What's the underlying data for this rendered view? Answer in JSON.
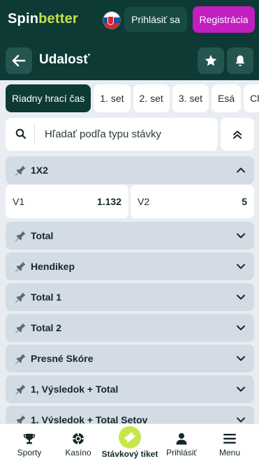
{
  "header": {
    "logo_spin": "Spin",
    "logo_better": "better",
    "login_label": "Prihlásiť sa",
    "register_label": "Registrácia"
  },
  "subheader": {
    "title": "Udalosť"
  },
  "tabs": [
    {
      "label": "Riadny hrací čas",
      "active": true
    },
    {
      "label": "1. set"
    },
    {
      "label": "2. set"
    },
    {
      "label": "3. set"
    },
    {
      "label": "Esá"
    },
    {
      "label": "Ch"
    }
  ],
  "search": {
    "placeholder": "Hľadať podľa typu stávky"
  },
  "markets": [
    {
      "name": "1X2",
      "expanded": true
    },
    {
      "name": "Total"
    },
    {
      "name": "Hendikep"
    },
    {
      "name": "Total 1"
    },
    {
      "name": "Total 2"
    },
    {
      "name": "Presné Skóre"
    },
    {
      "name": "1, Výsledok + Total"
    },
    {
      "name": "1, Výsledok + Total Setov"
    }
  ],
  "odds": [
    {
      "label": "V1",
      "value": "1.132"
    },
    {
      "label": "V2",
      "value": "5"
    }
  ],
  "bottom_nav": [
    {
      "label": "Sporty",
      "icon": "trophy-icon"
    },
    {
      "label": "Kasíno",
      "icon": "casino-chip-icon"
    },
    {
      "label": "Stávkový tiket",
      "icon": "ticket-icon"
    },
    {
      "label": "Prihlásiť",
      "icon": "user-icon"
    },
    {
      "label": "Menu",
      "icon": "hamburger-icon"
    }
  ],
  "colors": {
    "header_bg": "#0d3a35",
    "brand_accent": "#c7e04a",
    "register": "#c21ec0",
    "market_bg": "#d3dce5",
    "page_bg": "#e9edf2"
  }
}
